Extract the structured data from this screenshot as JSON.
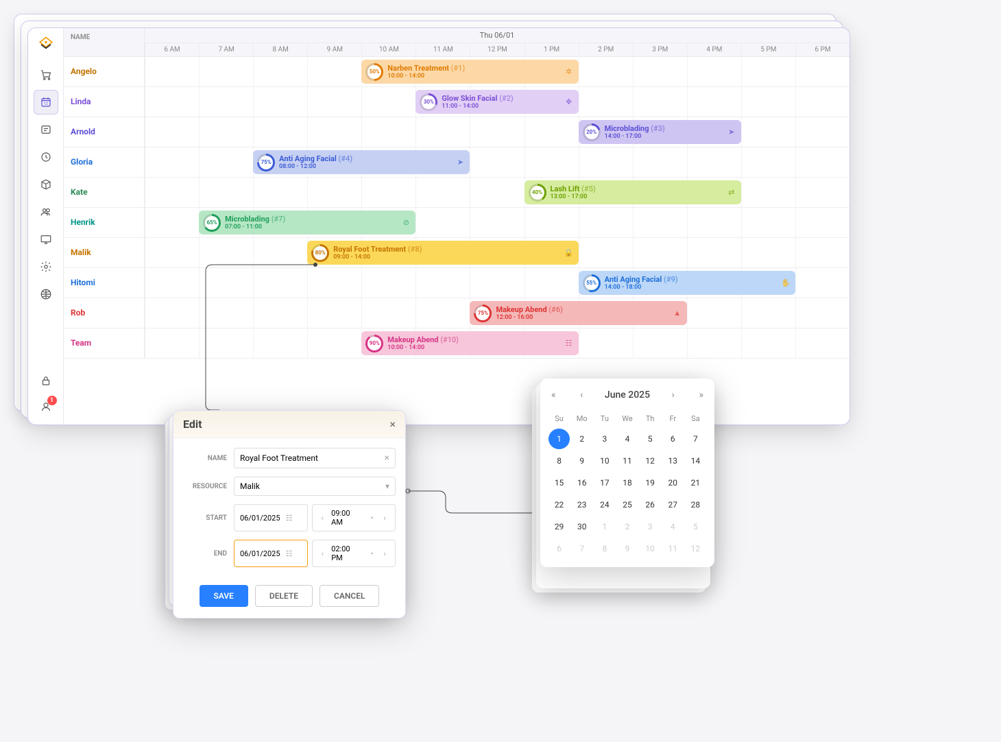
{
  "header": {
    "name_col": "NAME",
    "date_label": "Thu 06/01",
    "hours": [
      "6 AM",
      "7 AM",
      "8 AM",
      "9 AM",
      "10 AM",
      "11 AM",
      "12 PM",
      "1 PM",
      "2 PM",
      "3 PM",
      "4 PM",
      "5 PM",
      "6 PM"
    ]
  },
  "sidebar": {
    "badge_count": "1"
  },
  "resources": [
    {
      "name": "Angelo",
      "color": "#c47400"
    },
    {
      "name": "Linda",
      "color": "#7b4fd6"
    },
    {
      "name": "Arnold",
      "color": "#5b4fd6"
    },
    {
      "name": "Gloria",
      "color": "#1e6fd9"
    },
    {
      "name": "Kate",
      "color": "#2e8b57"
    },
    {
      "name": "Henrik",
      "color": "#009688"
    },
    {
      "name": "Malik",
      "color": "#c47400"
    },
    {
      "name": "Hitomi",
      "color": "#1e6fd9"
    },
    {
      "name": "Rob",
      "color": "#d33"
    },
    {
      "name": "Team",
      "color": "#d63384"
    }
  ],
  "events": [
    {
      "row": 0,
      "start": 10,
      "end": 14,
      "pct": "50%",
      "title": "Narben Treatment",
      "num": "(#1)",
      "time": "10:00 - 14:00",
      "bg": "#fcd8a6",
      "fg": "#e07b00",
      "icon": "gear"
    },
    {
      "row": 1,
      "start": 11,
      "end": 14,
      "pct": "30%",
      "title": "Glow Skin Facial",
      "num": "(#2)",
      "time": "11:00 - 14:00",
      "bg": "#e1cff5",
      "fg": "#7b4fd6",
      "icon": "move"
    },
    {
      "row": 2,
      "start": 14,
      "end": 17,
      "pct": "20%",
      "title": "Microblading",
      "num": "(#3)",
      "time": "14:00 - 17:00",
      "bg": "#cfc5f2",
      "fg": "#5b4fd6",
      "icon": "cursor"
    },
    {
      "row": 3,
      "start": 8,
      "end": 12,
      "pct": "75%",
      "title": "Anti Aging Facial",
      "num": "(#4)",
      "time": "08:00 - 12:00",
      "bg": "#c6d0f2",
      "fg": "#3b5bd6",
      "icon": "cursor"
    },
    {
      "row": 4,
      "start": 13,
      "end": 17,
      "pct": "40%",
      "title": "Lash Lift",
      "num": "(#5)",
      "time": "13:00 - 17:00",
      "bg": "#d6ec9e",
      "fg": "#6da000",
      "icon": "swap"
    },
    {
      "row": 5,
      "start": 7,
      "end": 11,
      "pct": "65%",
      "title": "Microblading",
      "num": "(#7)",
      "time": "07:00 - 11:00",
      "bg": "#b6e7c5",
      "fg": "#1e9e5a",
      "icon": "block"
    },
    {
      "row": 6,
      "start": 9,
      "end": 14,
      "pct": "80%",
      "title": "Royal Foot Treatment",
      "num": "(#8)",
      "time": "09:00 - 14:00",
      "bg": "#fcd85a",
      "fg": "#c47400",
      "icon": "lock"
    },
    {
      "row": 7,
      "start": 14,
      "end": 18,
      "pct": "55%",
      "title": "Anti Aging Facial",
      "num": "(#9)",
      "time": "14:00 - 18:00",
      "bg": "#bcd7f7",
      "fg": "#1e6fd9",
      "icon": "hand"
    },
    {
      "row": 8,
      "start": 12,
      "end": 16,
      "pct": "75%",
      "title": "Makeup Abend",
      "num": "(#6)",
      "time": "12:00 - 16:00",
      "bg": "#f5b8b8",
      "fg": "#d33",
      "icon": "warn"
    },
    {
      "row": 9,
      "start": 10,
      "end": 14,
      "pct": "90%",
      "title": "Makeup Abend",
      "num": "(#10)",
      "time": "10:00 - 14:00",
      "bg": "#f7c6da",
      "fg": "#d63384",
      "icon": "date"
    }
  ],
  "edit": {
    "title": "Edit",
    "labels": {
      "name": "NAME",
      "resource": "RESOURCE",
      "start": "START",
      "end": "END"
    },
    "name_value": "Royal Foot Treatment",
    "resource_value": "Malik",
    "start_date": "06/01/2025",
    "start_time": "09:00 AM",
    "end_date": "06/01/2025",
    "end_time": "02:00 PM",
    "buttons": {
      "save": "SAVE",
      "delete": "DELETE",
      "cancel": "CANCEL"
    }
  },
  "calendar": {
    "title": "June 2025",
    "dow": [
      "Su",
      "Mo",
      "Tu",
      "We",
      "Th",
      "Fr",
      "Sa"
    ],
    "selected": 1,
    "days": [
      {
        "n": 1,
        "sel": true
      },
      {
        "n": 2
      },
      {
        "n": 3
      },
      {
        "n": 4
      },
      {
        "n": 5
      },
      {
        "n": 6
      },
      {
        "n": 7
      },
      {
        "n": 8
      },
      {
        "n": 9
      },
      {
        "n": 10
      },
      {
        "n": 11
      },
      {
        "n": 12
      },
      {
        "n": 13
      },
      {
        "n": 14
      },
      {
        "n": 15
      },
      {
        "n": 16
      },
      {
        "n": 17
      },
      {
        "n": 18
      },
      {
        "n": 19
      },
      {
        "n": 20
      },
      {
        "n": 21
      },
      {
        "n": 22
      },
      {
        "n": 23
      },
      {
        "n": 24
      },
      {
        "n": 25
      },
      {
        "n": 26
      },
      {
        "n": 27
      },
      {
        "n": 28
      },
      {
        "n": 29
      },
      {
        "n": 30
      },
      {
        "n": 1,
        "other": true
      },
      {
        "n": 2,
        "other": true
      },
      {
        "n": 3,
        "other": true
      },
      {
        "n": 4,
        "other": true
      },
      {
        "n": 5,
        "other": true
      },
      {
        "n": 6,
        "other": true
      },
      {
        "n": 7,
        "other": true
      },
      {
        "n": 8,
        "other": true
      },
      {
        "n": 9,
        "other": true
      },
      {
        "n": 10,
        "other": true
      },
      {
        "n": 11,
        "other": true
      },
      {
        "n": 12,
        "other": true
      }
    ]
  },
  "timeline": {
    "start": 6,
    "end": 19
  }
}
